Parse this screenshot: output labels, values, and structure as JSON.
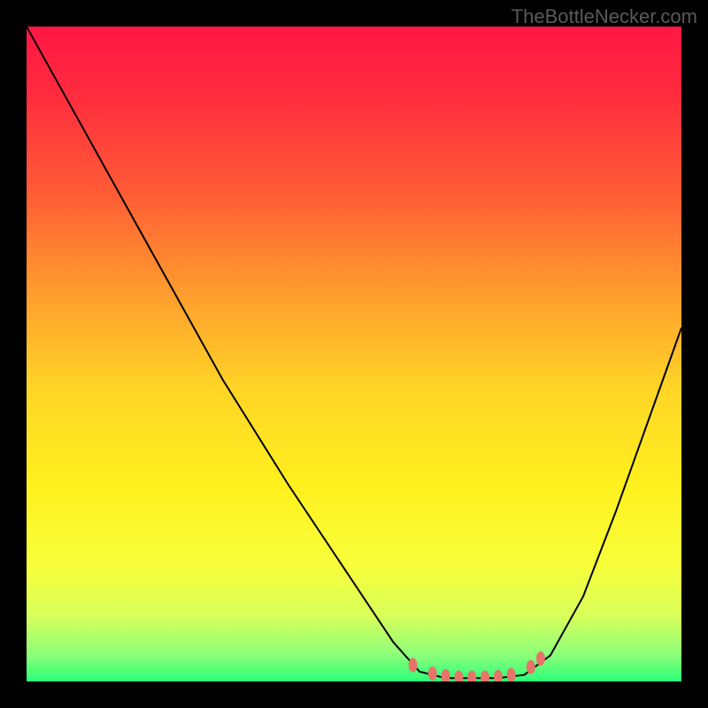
{
  "watermark": "TheBottleNecker.com",
  "chart_data": {
    "type": "line",
    "title": "",
    "xlabel": "",
    "ylabel": "",
    "xlim": [
      0,
      100
    ],
    "ylim": [
      0,
      100
    ],
    "gradient_stops": [
      {
        "offset": 0,
        "color": "#ff1744"
      },
      {
        "offset": 0.1,
        "color": "#ff2b3e"
      },
      {
        "offset": 0.25,
        "color": "#ff5a36"
      },
      {
        "offset": 0.4,
        "color": "#ff9a2e"
      },
      {
        "offset": 0.55,
        "color": "#ffd426"
      },
      {
        "offset": 0.7,
        "color": "#fff01e"
      },
      {
        "offset": 0.82,
        "color": "#f8ff3a"
      },
      {
        "offset": 0.9,
        "color": "#d8ff5a"
      },
      {
        "offset": 0.96,
        "color": "#8bff7a"
      },
      {
        "offset": 1.0,
        "color": "#2bff77"
      }
    ],
    "curve_points": [
      {
        "x": 0,
        "y": 100
      },
      {
        "x": 10,
        "y": 82
      },
      {
        "x": 20,
        "y": 64
      },
      {
        "x": 30,
        "y": 46
      },
      {
        "x": 40,
        "y": 30
      },
      {
        "x": 50,
        "y": 15
      },
      {
        "x": 56,
        "y": 6
      },
      {
        "x": 60,
        "y": 1.5
      },
      {
        "x": 64,
        "y": 0.5
      },
      {
        "x": 68,
        "y": 0.5
      },
      {
        "x": 72,
        "y": 0.5
      },
      {
        "x": 76,
        "y": 1.0
      },
      {
        "x": 80,
        "y": 4
      },
      {
        "x": 85,
        "y": 13
      },
      {
        "x": 90,
        "y": 26
      },
      {
        "x": 95,
        "y": 40
      },
      {
        "x": 100,
        "y": 54
      }
    ],
    "markers": [
      {
        "x": 59,
        "y": 2.5
      },
      {
        "x": 62,
        "y": 1.2
      },
      {
        "x": 64,
        "y": 0.8
      },
      {
        "x": 66,
        "y": 0.6
      },
      {
        "x": 68,
        "y": 0.6
      },
      {
        "x": 70,
        "y": 0.6
      },
      {
        "x": 72,
        "y": 0.7
      },
      {
        "x": 74,
        "y": 1.0
      },
      {
        "x": 77,
        "y": 2.2
      },
      {
        "x": 78.5,
        "y": 3.5
      }
    ]
  }
}
